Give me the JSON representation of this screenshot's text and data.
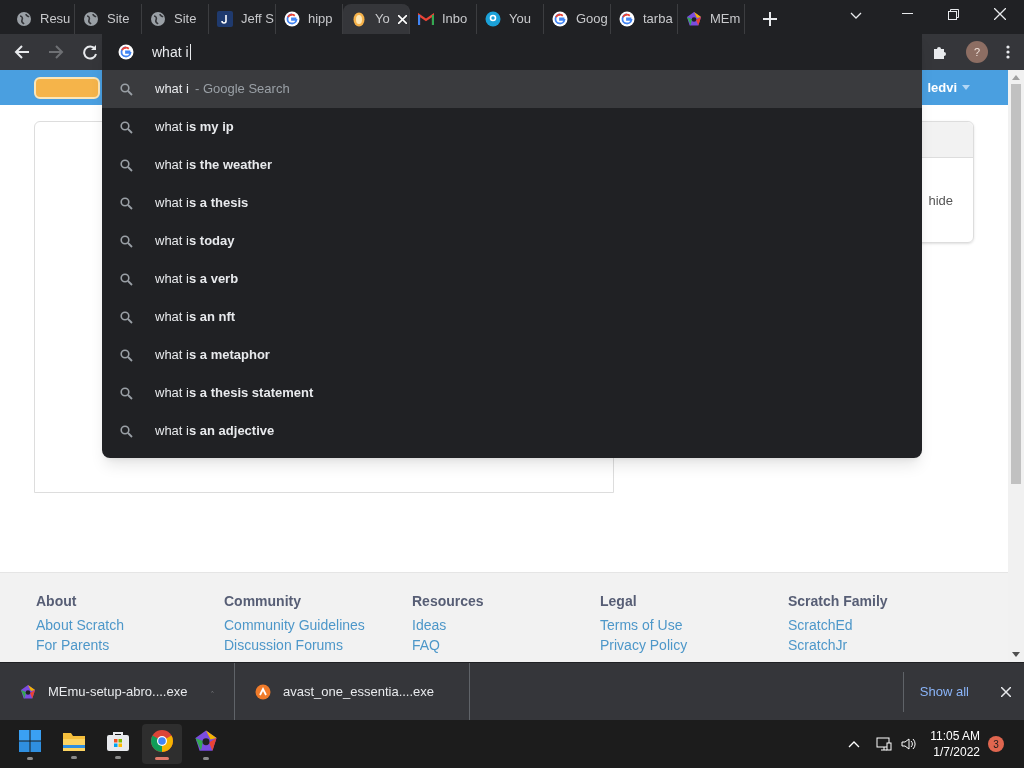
{
  "tabs": [
    {
      "title": "Resu",
      "kind": "globe",
      "selected": false
    },
    {
      "title": "Site",
      "kind": "globe",
      "selected": false
    },
    {
      "title": "Site",
      "kind": "globe",
      "selected": false
    },
    {
      "title": "Jeff S",
      "kind": "letter",
      "selected": false
    },
    {
      "title": "hipp",
      "kind": "google",
      "selected": false
    },
    {
      "title": "Yo",
      "kind": "cat",
      "selected": true
    },
    {
      "title": "Inbo",
      "kind": "mail",
      "selected": false
    },
    {
      "title": "You",
      "kind": "bubble",
      "selected": false
    },
    {
      "title": "Goog",
      "kind": "google",
      "selected": false
    },
    {
      "title": "tarba",
      "kind": "google",
      "selected": false
    },
    {
      "title": "MEm",
      "kind": "pentagon",
      "selected": false
    }
  ],
  "omnibox": {
    "value": "what i"
  },
  "suggestions": [
    {
      "text": "what i",
      "suffix": "- Google Search",
      "selected": true
    },
    {
      "text": "what i**s my ip**",
      "selected": false
    },
    {
      "text": "what i**s the weather**",
      "selected": false
    },
    {
      "text": "what i**s a thesis**",
      "selected": false
    },
    {
      "text": "what i**s today**",
      "selected": false
    },
    {
      "text": "what i**s a verb**",
      "selected": false
    },
    {
      "text": "what i**s an nft**",
      "selected": false
    },
    {
      "text": "what i**s a metaphor**",
      "selected": false
    },
    {
      "text": "what i**s a thesis statement**",
      "selected": false
    },
    {
      "text": "what i**s an adjective**",
      "selected": false
    }
  ],
  "profile": {
    "initial": "?"
  },
  "page": {
    "username": "ledvi",
    "card_text": "hide",
    "footer": [
      {
        "heading": "About",
        "links": [
          "About Scratch",
          "For Parents"
        ]
      },
      {
        "heading": "Community",
        "links": [
          "Community Guidelines",
          "Discussion Forums"
        ]
      },
      {
        "heading": "Resources",
        "links": [
          "Ideas",
          "FAQ"
        ]
      },
      {
        "heading": "Legal",
        "links": [
          "Terms of Use",
          "Privacy Policy"
        ]
      },
      {
        "heading": "Scratch Family",
        "links": [
          "ScratchEd",
          "ScratchJr"
        ]
      }
    ]
  },
  "downloads": [
    {
      "name": "MEmu-setup-abro....exe",
      "kind": "pentagon"
    },
    {
      "name": "avast_one_essentia....exe",
      "kind": "avast"
    }
  ],
  "show_all": "Show all",
  "taskbar": {
    "apps": [
      {
        "kind": "start",
        "active": false
      },
      {
        "kind": "folder",
        "active": false
      },
      {
        "kind": "store",
        "active": false
      },
      {
        "kind": "chrome",
        "active": true
      },
      {
        "kind": "pentagon",
        "active": false
      }
    ],
    "time": "11:05 AM",
    "date": "1/7/2022",
    "notifications": "3"
  }
}
